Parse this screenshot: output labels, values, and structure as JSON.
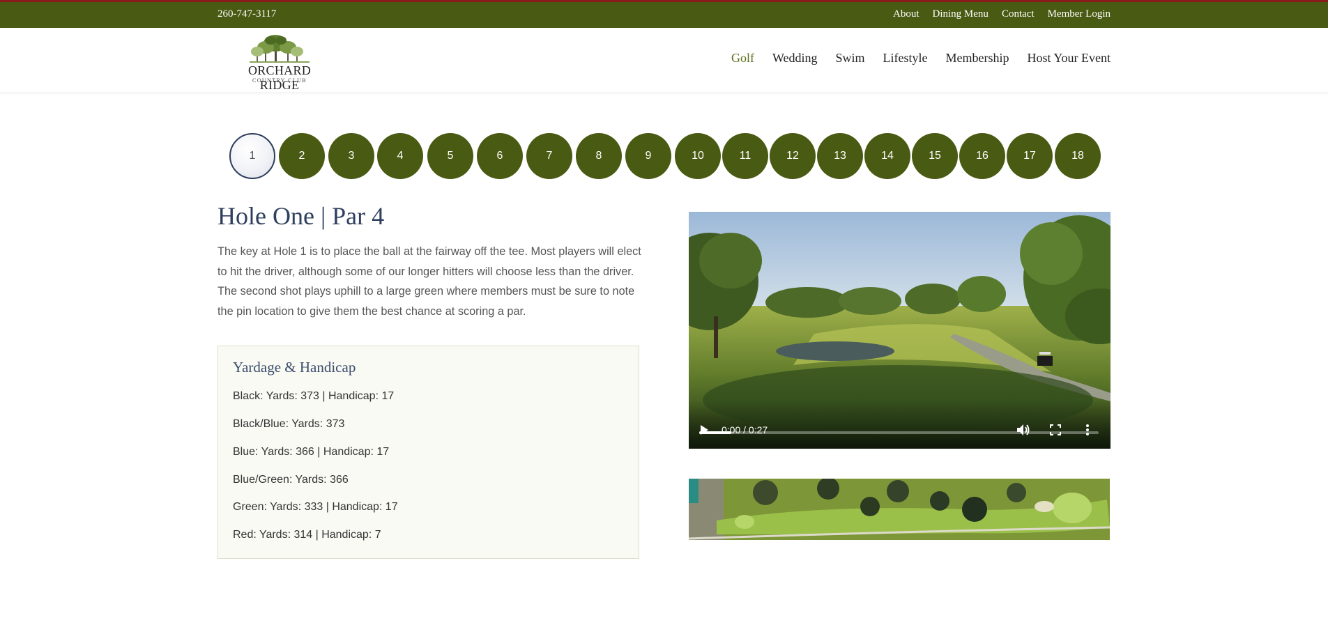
{
  "topbar": {
    "phone": "260-747-3117",
    "links": [
      "About",
      "Dining Menu",
      "Contact",
      "Member Login"
    ]
  },
  "logo": {
    "name": "ORCHARD RIDGE",
    "sub": "COUNTRY CLUB"
  },
  "nav": {
    "items": [
      "Golf",
      "Wedding",
      "Swim",
      "Lifestyle",
      "Membership",
      "Host Your Event"
    ],
    "active": "Golf"
  },
  "holes": {
    "labels": [
      "1",
      "2",
      "3",
      "4",
      "5",
      "6",
      "7",
      "8",
      "9",
      "10",
      "11",
      "12",
      "13",
      "14",
      "15",
      "16",
      "17",
      "18"
    ],
    "selected": "1"
  },
  "hole": {
    "title": "Hole One | Par 4",
    "description": "The key at Hole 1 is to place the ball at the fairway off the tee. Most players will elect to hit the driver, although some of our longer hitters will choose less than the driver. The second shot plays uphill to a large green where members must be sure to note the pin location to give them the best chance at scoring a par."
  },
  "yardage": {
    "heading": "Yardage & Handicap",
    "rows": [
      "Black: Yards: 373 | Handicap: 17",
      "Black/Blue: Yards:  373",
      "Blue: Yards: 366 | Handicap: 17",
      "Blue/Green: Yards: 366",
      "Green: Yards: 333 | Handicap: 17",
      "Red: Yards: 314 | Handicap: 7"
    ]
  },
  "video": {
    "time": "0:00 / 0:27",
    "progress": 0.08
  },
  "colors": {
    "brand_green": "#495a12",
    "title_blue": "#2e3f5e",
    "top_accent_red": "#8b1a1a"
  },
  "icons": {
    "play": "play-icon",
    "volume": "volume-icon",
    "fullscreen": "fullscreen-icon",
    "more": "more-vert-icon"
  }
}
